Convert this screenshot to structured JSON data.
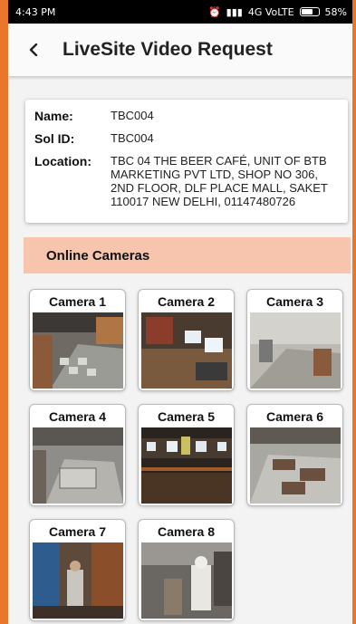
{
  "status_bar": {
    "time": "4:43 PM",
    "network": "4G VoLTE",
    "battery": "58%"
  },
  "app_bar": {
    "back_icon": "back-arrow-icon",
    "title": "LiveSite Video Request"
  },
  "site_info": {
    "name_label": "Name:",
    "name_value": "TBC004",
    "sol_label": "Sol ID:",
    "sol_value": "TBC004",
    "location_label": "Location:",
    "location_value": "TBC 04 THE BEER CAFÉ, UNIT OF BTB MARKETING PVT LTD, SHOP NO 306, 2ND FLOOR, DLF PLACE MALL, SAKET 110017 NEW DELHI, 01147480726"
  },
  "section": {
    "title": "Online Cameras"
  },
  "cameras": [
    {
      "label": "Camera 1"
    },
    {
      "label": "Camera 2"
    },
    {
      "label": "Camera 3"
    },
    {
      "label": "Camera 4"
    },
    {
      "label": "Camera 5"
    },
    {
      "label": "Camera 6"
    },
    {
      "label": "Camera 7"
    },
    {
      "label": "Camera 8"
    }
  ],
  "colors": {
    "accent_border": "#e9762b",
    "section_bg": "#f7c4ad"
  }
}
